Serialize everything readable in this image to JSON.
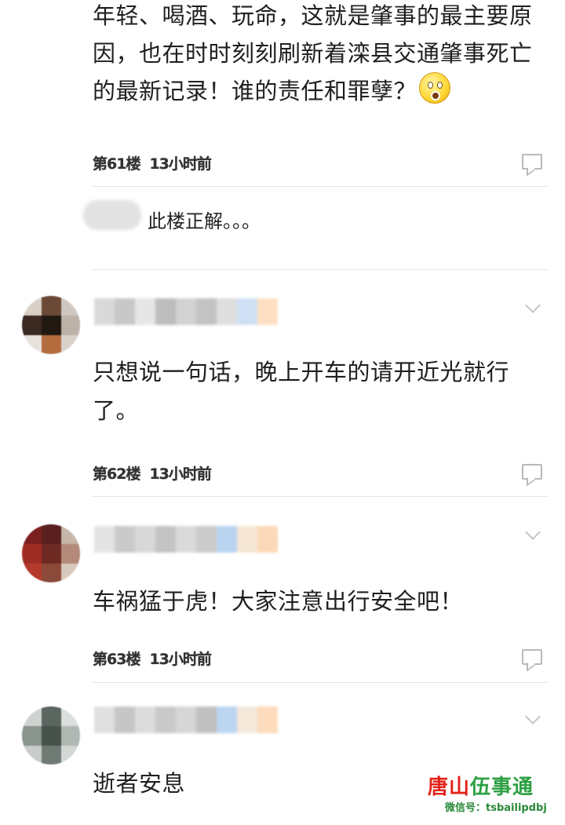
{
  "post_top": {
    "lines": [
      "年轻、喝酒、玩命，这就是肇事的最主要原",
      "因，也在时时刻刻刷新着滦县交通肇事死亡",
      "的最新记录！谁的责任和罪孽？"
    ],
    "emoji_icon": "astonished-face-icon",
    "floor": "第61楼",
    "time": "13小时前"
  },
  "reply": {
    "text": "此楼正解。。。"
  },
  "comments": [
    {
      "lines": [
        "只想说一句话，晚上开车的请开近光就行",
        "了。"
      ],
      "floor": "第62楼",
      "time": "13小时前"
    },
    {
      "lines": [
        "车祸猛于虎！大家注意出行安全吧！"
      ],
      "floor": "第63楼",
      "time": "13小时前"
    },
    {
      "lines": [
        "逝者安息"
      ]
    }
  ],
  "icons": {
    "reply": "comment-bubble-icon",
    "more": "chevron-down-icon"
  },
  "watermark": {
    "main_red": "唐山",
    "main_green": "伍事通",
    "sub": "微信号：tsbailipdbj"
  },
  "colors": {
    "text": "#1f1f1f",
    "divider": "#e6e6e6",
    "icon": "#b9b9b9",
    "watermark_red": "#e2231a",
    "watermark_green": "#2ea043"
  }
}
